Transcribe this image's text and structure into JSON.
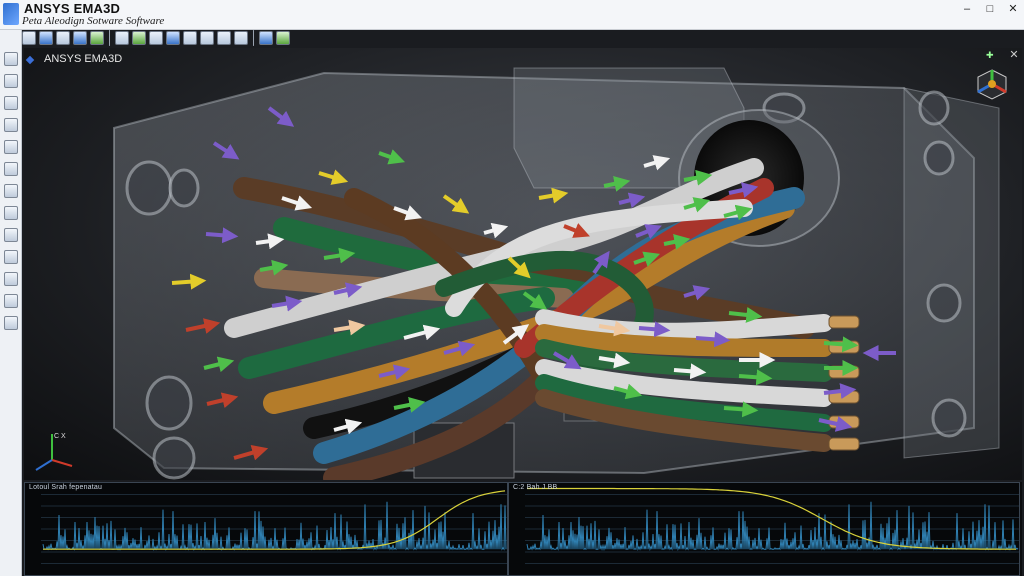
{
  "app": {
    "title": "ANSYS EMA3D",
    "subtitle": "Peta Aleodign Sotware Software"
  },
  "window_controls": {
    "minimize": "–",
    "maximize": "□",
    "close": "✕"
  },
  "viewport": {
    "label": "ANSYS EMA3D",
    "close": "✕"
  },
  "toolbar_icons": [
    "open-icon",
    "select-icon",
    "pick-icon",
    "zoom-icon",
    "pan-icon",
    "rotate-icon",
    "mesh-icon",
    "probe-icon",
    "export-icon",
    "move-icon",
    "line-icon",
    "curve-icon",
    "arrow-icon",
    "render-icon",
    "view-icon"
  ],
  "left_tool_icons": [
    "document-icon",
    "shape-icon",
    "line-icon",
    "wire-icon",
    "curve-icon",
    "probe-icon",
    "color-icon",
    "box-icon",
    "source-icon",
    "chart-icon",
    "sim-icon",
    "cube-icon",
    "layers-icon"
  ],
  "triad": {
    "axis_label": "C X"
  },
  "colors": {
    "signal": "#2f7fb0",
    "envelope": "#d9d23a",
    "accent": "#c0402b"
  },
  "waveform_panels": [
    {
      "title": "Lotoul Srah fepenatau"
    },
    {
      "title": "C:2 Bah J BB"
    }
  ]
}
